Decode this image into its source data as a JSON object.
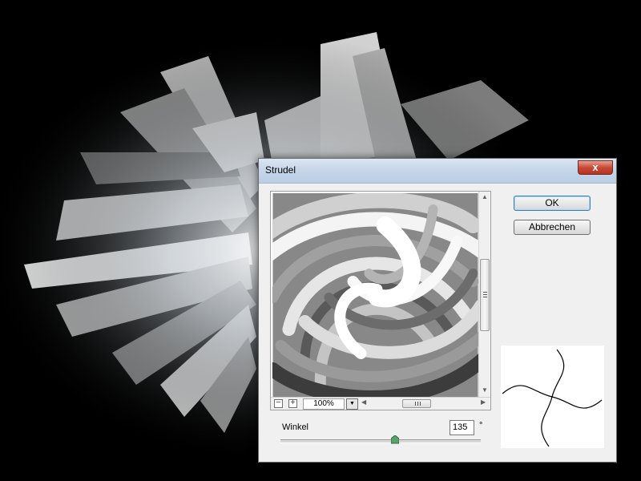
{
  "dialog": {
    "title": "Strudel",
    "close_label": "x",
    "ok_label": "OK",
    "cancel_label": "Abbrechen",
    "zoom_out_label": "−",
    "zoom_in_label": "+",
    "zoom_level": "100%",
    "angle_label": "Winkel",
    "angle_value": "135",
    "degree_symbol": "°",
    "angle_slider_fraction": 0.57
  },
  "icons": [
    "close-icon",
    "zoom-out-icon",
    "zoom-in-icon",
    "chevron-down-icon",
    "arrow-left-icon",
    "arrow-right-icon",
    "arrow-up-icon",
    "arrow-down-icon",
    "slider-thumb-icon"
  ],
  "colors": {
    "titlebar": "#c8d8ea",
    "close_button": "#c74a36",
    "dialog_bg": "#f0f0f0",
    "ok_border": "#3c7fb1"
  }
}
